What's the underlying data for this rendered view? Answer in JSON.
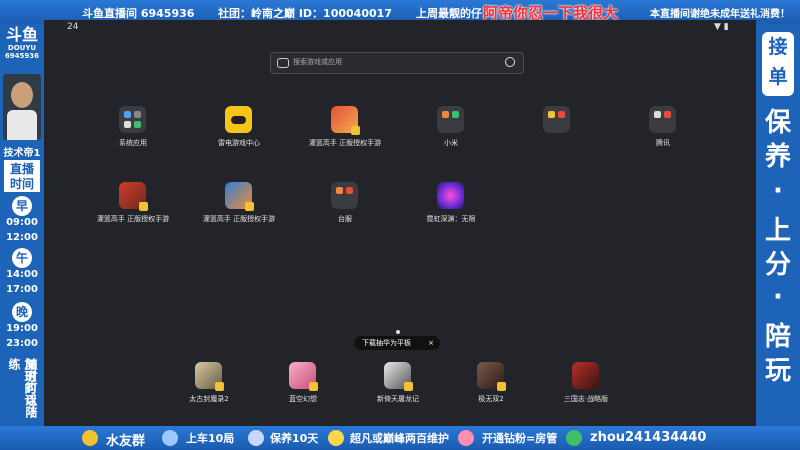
{
  "top_banner": {
    "room": "斗鱼直播间 6945936",
    "club": "社团：岭南之巅 ID：100040017",
    "best_label": "上周最靓的仔：",
    "best_name": "阿帝你忍一下我很大",
    "notice": "本直播间谢绝未成年送礼消费！"
  },
  "left_panel": {
    "logo": "斗鱼",
    "logo_sub1": "DOUYU",
    "logo_sub2": "6945936",
    "streamer_title": "技术帝1",
    "schedule_title_1": "直播",
    "schedule_title_2": "时间",
    "morning": "早",
    "t1": "09:00",
    "t2": "12:00",
    "noon": "午",
    "t3": "14:00",
    "t4": "17:00",
    "evening": "晚",
    "t5": "19:00",
    "t6": "23:00",
    "note1": "加班的话！",
    "note2": "随时可以陪练"
  },
  "right_panel": {
    "badge": "接单",
    "line1": "保养",
    "line2": "上分",
    "line3": "陪玩"
  },
  "screen": {
    "clock": "24",
    "search_placeholder": "搜索游戏或应用",
    "apps_row1": [
      {
        "label": "系统应用",
        "icon": "folder-icon"
      },
      {
        "label": "雷电游戏中心",
        "icon": "gamepad-icon"
      },
      {
        "label": "灌篮高手 正版授权手游",
        "icon": "slamdunk-icon"
      },
      {
        "label": "小米",
        "icon": "folder-icon"
      },
      {
        "label": "",
        "icon": "folder-icon"
      },
      {
        "label": "腾讯",
        "icon": "folder-icon"
      }
    ],
    "apps_row2": [
      {
        "label": "灌篮高手 正版授权手游",
        "icon": "slamdunk-icon"
      },
      {
        "label": "灌篮高手 正版授权手游",
        "icon": "slamdunk-icon"
      },
      {
        "label": "台服",
        "icon": "folder-icon"
      },
      {
        "label": "霓虹深渊：无限",
        "icon": "neon-abyss-icon"
      }
    ],
    "toast": "下载抽华为平板",
    "toast_close": "×",
    "dock": [
      {
        "label": "太古封魔录2"
      },
      {
        "label": "蓝空幻想"
      },
      {
        "label": "新倚天屠龙记"
      },
      {
        "label": "极无双2"
      },
      {
        "label": "三国志·战略版"
      }
    ]
  },
  "bottom_bar": {
    "b1": "水友群",
    "b2": "上车10局",
    "b3": "保养10天",
    "b4": "超凡或巅峰两百维护",
    "b5": "开通钻粉=房管",
    "b6": "zhou241434440"
  },
  "colors": {
    "frame_blue": "#1d63b8",
    "screen_bg": "#222429",
    "highlight_red": "#ff2f2f"
  }
}
